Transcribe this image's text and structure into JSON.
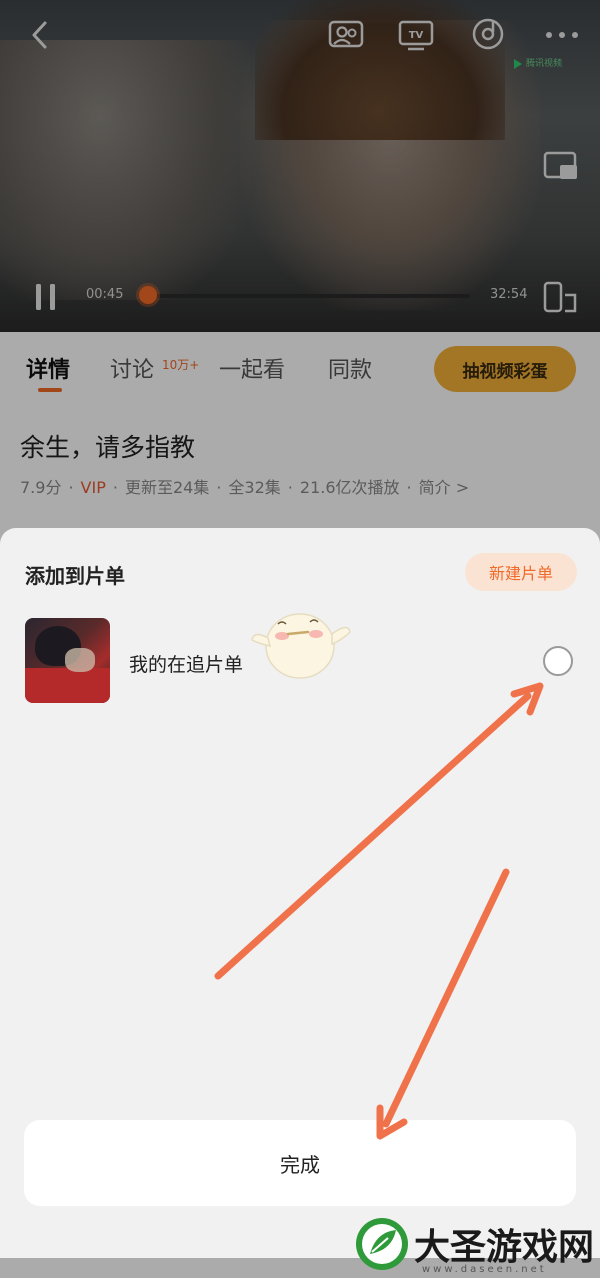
{
  "player": {
    "current_time": "00:45",
    "total_time": "32:54",
    "progress": 0.0,
    "watermark": "腾讯视频"
  },
  "tabs": {
    "items": [
      {
        "label": "详情"
      },
      {
        "label": "讨论"
      },
      {
        "label": "一起看"
      },
      {
        "label": "同款"
      }
    ],
    "discussion_count": "10万+",
    "active_index": 0,
    "easter_egg_label": "抽视频彩蛋"
  },
  "show": {
    "title": "余生，请多指教",
    "score": "7.9分",
    "vip": "VIP",
    "update": "更新至24集",
    "total": "全32集",
    "plays": "21.6亿次播放",
    "intro": "简介 >"
  },
  "sheet": {
    "title": "添加到片单",
    "new_list_label": "新建片单",
    "lists": [
      {
        "name": "我的在追片单",
        "selected": false
      }
    ],
    "done_label": "完成"
  },
  "brand": {
    "site_name": "大圣游戏网",
    "site_url": "www.daseen.net"
  },
  "colors": {
    "accent": "#f06a28",
    "arrow": "#f0724a"
  }
}
